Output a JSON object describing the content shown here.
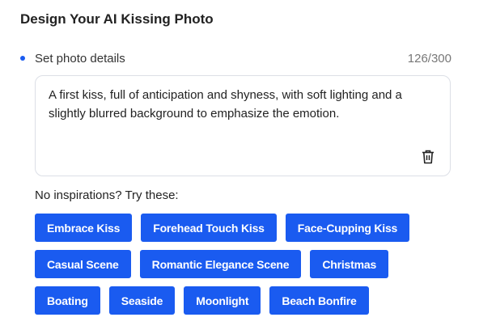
{
  "title": "Design Your AI Kissing Photo",
  "details": {
    "label": "Set photo details",
    "counter": "126/300",
    "text": "A first kiss, full of anticipation and shyness, with soft lighting and a slightly blurred background to emphasize the emotion."
  },
  "inspirations": {
    "label": "No inspirations?  Try these:",
    "rows": [
      [
        "Embrace Kiss",
        "Forehead Touch Kiss",
        "Face-Cupping Kiss"
      ],
      [
        "Casual Scene",
        "Romantic Elegance Scene",
        "Christmas"
      ],
      [
        "Boating",
        "Seaside",
        "Moonlight",
        "Beach Bonfire"
      ]
    ]
  },
  "colors": {
    "accent": "#1a5bf0"
  },
  "icons": {
    "clear": "trash-icon"
  }
}
